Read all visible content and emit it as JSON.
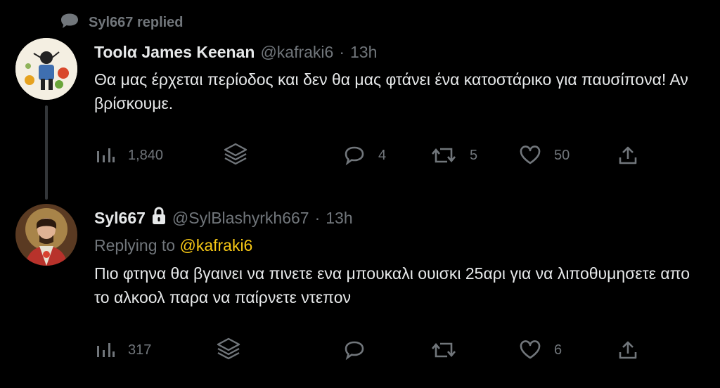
{
  "social_context": {
    "text": "Syl667 replied"
  },
  "tweets": [
    {
      "name": "Toolα James Keenan",
      "handle": "@kafraki6",
      "separator": "·",
      "time": "13h",
      "text": "Θα μας έρχεται περίοδος και δεν θα μας φτάνει ένα κατοστάρικο για παυσίπονα! Αν βρίσκουμε.",
      "actions": {
        "views": "1,840",
        "replies": "4",
        "retweets": "5",
        "likes": "50"
      }
    },
    {
      "name": "Syl667",
      "protected": true,
      "handle": "@SylBlashyrkh667",
      "separator": "·",
      "time": "13h",
      "replying_prefix": "Replying to",
      "replying_to": "@kafraki6",
      "text": "Πιο φτηνα θα βγαινει να πινετε ενα μπουκαλι ουισκι 25αρι για να λιποθυμησετε απο το αλκοολ παρα να παίρνετε ντεπον",
      "actions": {
        "views": "317",
        "replies": "",
        "retweets": "",
        "likes": "6"
      }
    }
  ],
  "colors": {
    "background": "#000000",
    "text": "#e7e9ea",
    "muted": "#71767b",
    "mention": "#f7c815"
  },
  "icons": [
    "reply-bubble-icon",
    "avatar",
    "lock-icon",
    "views-icon",
    "layers-icon",
    "reply-icon",
    "retweet-icon",
    "like-icon",
    "share-icon"
  ]
}
